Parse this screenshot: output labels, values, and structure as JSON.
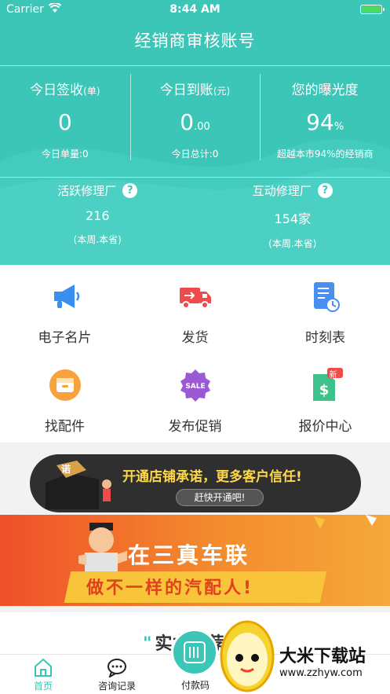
{
  "status_bar": {
    "carrier": "Carrier",
    "time": "8:44 AM"
  },
  "nav": {
    "title": "经销商审核账号"
  },
  "stats": [
    {
      "label": "今日签收",
      "unit": "(单)",
      "value": "0",
      "value_suffix": "",
      "sub": "今日单量:0"
    },
    {
      "label": "今日到账",
      "unit": "(元)",
      "value": "0",
      "value_suffix": ".00",
      "sub": "今日总计:0"
    },
    {
      "label": "您的曝光度",
      "unit": "",
      "value": "94",
      "value_suffix": "%",
      "sub": "超越本市94%的经销商"
    }
  ],
  "factories": [
    {
      "label": "活跃修理厂",
      "help": "?",
      "value": "216",
      "note": "(本周.本省)"
    },
    {
      "label": "互动修理厂",
      "help": "?",
      "value": "154家",
      "note": "(本周.本省)"
    }
  ],
  "features": [
    {
      "label": "电子名片",
      "icon": "megaphone-icon"
    },
    {
      "label": "发货",
      "icon": "delivery-truck-icon"
    },
    {
      "label": "时刻表",
      "icon": "schedule-icon"
    },
    {
      "label": "找配件",
      "icon": "parts-box-icon"
    },
    {
      "label": "发布促销",
      "icon": "sale-badge-icon"
    },
    {
      "label": "报价中心",
      "icon": "quote-dollar-icon",
      "badge": "新"
    }
  ],
  "banner_promise": {
    "badge": "诺",
    "text": "开通店铺承诺，更多客户信任!",
    "button": "赶快开通吧!"
  },
  "banner_union": {
    "line1": "在三真车联",
    "line2": "做不一样的汽配人!"
  },
  "section": {
    "quote": "\"",
    "heading": "实力推荐"
  },
  "tabbar": {
    "tabs": [
      {
        "label": "首页",
        "active": true
      },
      {
        "label": "咨询记录",
        "active": false
      },
      {
        "label": "付款码",
        "active": false
      }
    ]
  },
  "watermark": {
    "text": "大米下载站",
    "url": "www.zzhyw.com"
  },
  "colors": {
    "primary": "#3cc6b8",
    "accent": "#f0502a",
    "gold": "#ffd94a"
  }
}
